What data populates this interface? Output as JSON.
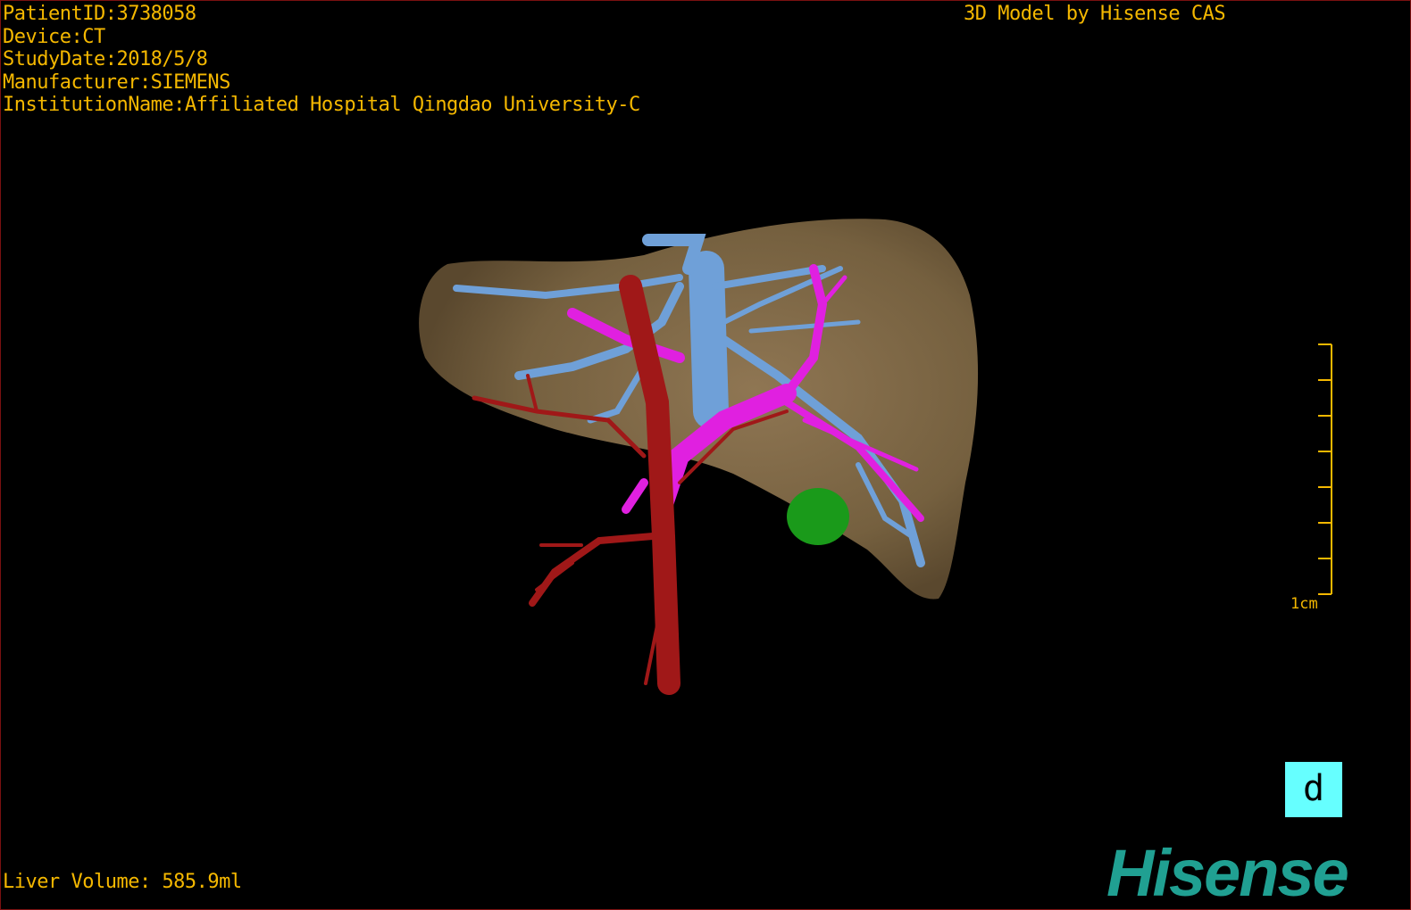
{
  "overlay": {
    "patient_id": "PatientID:3738058",
    "device": "Device:CT",
    "study_date": "StudyDate:2018/5/8",
    "manufacturer": "Manufacturer:SIEMENS",
    "institution": "InstitutionName:Affiliated Hospital Qingdao University-C",
    "credit": "3D Model by Hisense CAS",
    "liver_volume": "Liver Volume: 585.9ml",
    "scale_label": "1cm",
    "orientation_label": "d",
    "logo_text": "Hisense"
  },
  "colors": {
    "text": "#f5b800",
    "liver": "#7a6445",
    "hepatic_vein": "#6fa0d8",
    "portal_vein": "#e020e0",
    "artery": "#a01818",
    "lesion": "#1a9a1a",
    "orientation_bg": "#66ffff",
    "logo": "#20a092"
  }
}
